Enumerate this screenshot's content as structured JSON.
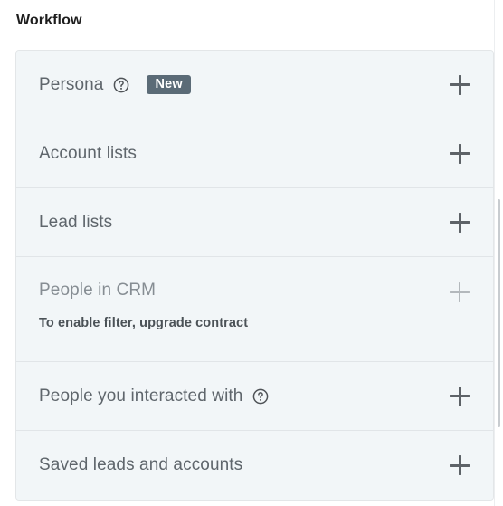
{
  "section": {
    "title": "Workflow"
  },
  "icons": {
    "help": "help-circle-icon",
    "add": "plus-icon"
  },
  "badges": {
    "new": "New"
  },
  "colors": {
    "row_background": "#f2f6f8",
    "row_divider": "#e1e5e8",
    "container_border": "#e3e6e8",
    "label_text": "#5f666c",
    "label_text_disabled": "#868d93",
    "sublabel_text": "#4b5257",
    "heading_text": "#1d1d1d",
    "badge_background": "#5b6b77",
    "badge_text": "#ffffff",
    "plus_icon": "#5d6267",
    "plus_icon_disabled": "#b3b8bc",
    "page_background": "#ffffff",
    "scrollbar_thumb": "#c8ccd0"
  },
  "filters": [
    {
      "label": "Persona",
      "has_help": true,
      "badge": "New",
      "enabled": true,
      "sublabel": null
    },
    {
      "label": "Account lists",
      "has_help": false,
      "badge": null,
      "enabled": true,
      "sublabel": null
    },
    {
      "label": "Lead lists",
      "has_help": false,
      "badge": null,
      "enabled": true,
      "sublabel": null
    },
    {
      "label": "People in CRM",
      "has_help": false,
      "badge": null,
      "enabled": false,
      "sublabel": "To enable filter, upgrade contract"
    },
    {
      "label": "People you interacted with",
      "has_help": true,
      "badge": null,
      "enabled": true,
      "sublabel": null
    },
    {
      "label": "Saved leads and accounts",
      "has_help": false,
      "badge": null,
      "enabled": true,
      "sublabel": null
    }
  ]
}
